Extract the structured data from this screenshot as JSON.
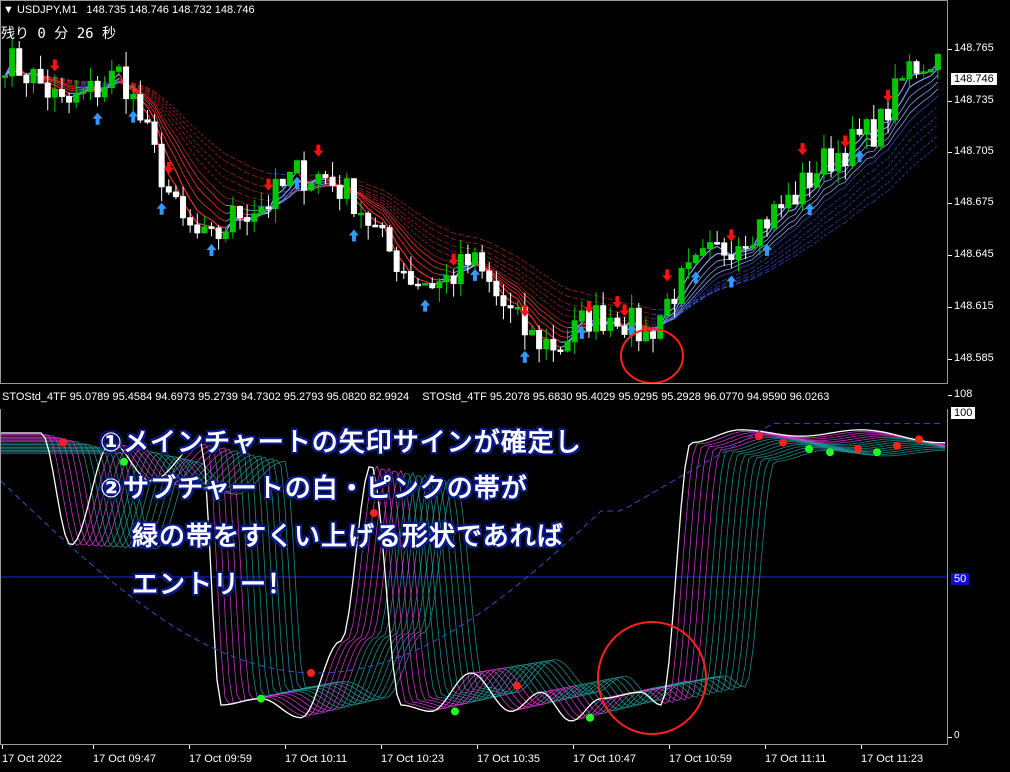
{
  "header": {
    "symbol": "USDJPY,M1",
    "ohlc": "148.735 148.746 148.732 148.746",
    "timer": "残り 0 分 26 秒"
  },
  "main_axis": {
    "ticks": [
      "148.765",
      "148.735",
      "148.705",
      "148.675",
      "148.645",
      "148.615",
      "148.585"
    ],
    "current_price": "148.746"
  },
  "indicator": {
    "header_left": "STOStd_4TF 95.0789 95.4584 94.6973 95.2739 94.7302 95.2793 95.0820 82.9924",
    "header_right": "STOStd_4TF 95.2078 95.6830 95.4029 95.9295 95.2928 96.0770 94.9590 96.0263",
    "axis_top": "108",
    "axis_100": "100",
    "axis_50": "50",
    "axis_0": "0"
  },
  "time_axis": [
    "17 Oct 2022",
    "17 Oct 09:47",
    "17 Oct 09:59",
    "17 Oct 10:11",
    "17 Oct 10:23",
    "17 Oct 10:35",
    "17 Oct 10:47",
    "17 Oct 10:59",
    "17 Oct 11:11",
    "17 Oct 11:23"
  ],
  "annotation": {
    "line1": "①メインチャートの矢印サインが確定し",
    "line2": "②サブチャートの白・ピンクの帯が",
    "line3": "緑の帯をすくい上げる形状であれば",
    "line4": "エントリー！"
  },
  "colors": {
    "bull": "#00c800",
    "bear": "#ffffff",
    "sell_arrow": "#ff1010",
    "buy_arrow": "#3399ff",
    "band_down": "#e03030",
    "band_up": "#4060ff",
    "highlight_circle": "#ff2020",
    "stoch_white": "#ffffff",
    "stoch_pink": "#e040e0",
    "stoch_teal": "#20a0a0",
    "level_50": "#2020ff"
  },
  "chart_data": {
    "type": "candlestick",
    "symbol": "USDJPY,M1",
    "ylim": [
      148.575,
      148.775
    ],
    "close_path": [
      148.745,
      148.735,
      148.72,
      148.728,
      148.738,
      148.7,
      148.66,
      148.648,
      148.665,
      148.67,
      148.685,
      148.683,
      148.672,
      148.648,
      148.63,
      148.628,
      148.64,
      148.618,
      148.6,
      148.595,
      148.61,
      148.612,
      148.6,
      148.625,
      148.64,
      148.65,
      148.66,
      148.672,
      148.69,
      148.7,
      148.71,
      148.74,
      148.746
    ],
    "sell_arrows_count": 14,
    "buy_arrows_count": 16
  }
}
